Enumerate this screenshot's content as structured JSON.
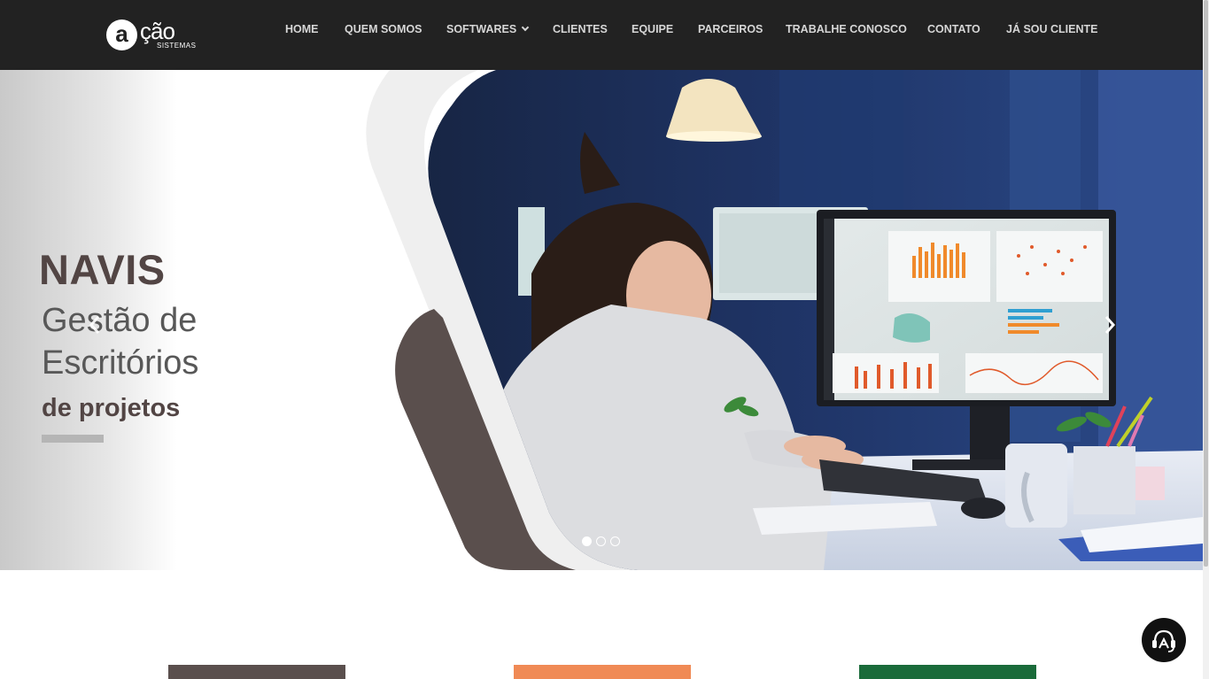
{
  "brand": {
    "logo_letter": "a",
    "logo_word": "ção",
    "logo_sub": "SISTEMAS"
  },
  "nav": {
    "items": [
      {
        "label": "HOME"
      },
      {
        "label": "QUEM SOMOS"
      },
      {
        "label": "SOFTWARES",
        "has_dropdown": true
      },
      {
        "label": "CLIENTES"
      },
      {
        "label": "EQUIPE"
      },
      {
        "label": "PARCEIROS"
      },
      {
        "label": "TRABALHE CONOSCO"
      },
      {
        "label": "CONTATO"
      },
      {
        "label": "JÁ SOU CLIENTE"
      }
    ]
  },
  "hero": {
    "title": "NAVIS",
    "line1": "Gestão de",
    "line2": "Escritórios",
    "line3": "de projetos",
    "slides_total": 3,
    "active_slide": 1,
    "prev_icon": "chevron-left-icon",
    "next_icon": "chevron-right-icon"
  },
  "cards": [
    {
      "color": "#5a4f4d"
    },
    {
      "color": "#f08a55"
    },
    {
      "color": "#1a6b3a"
    }
  ],
  "chat": {
    "icon": "headset-support-icon"
  },
  "colors": {
    "header_bg": "#222222",
    "brand_dark": "#524544",
    "nav_text": "#d6d6d6"
  }
}
